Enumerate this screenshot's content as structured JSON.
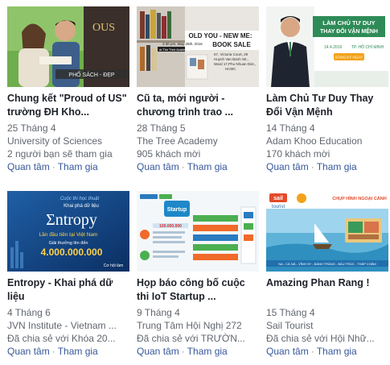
{
  "events": [
    {
      "title": "Chung kết \"Proud of US\" trường ĐH Kho...",
      "date": "25 Tháng 4",
      "host": "University of Sciences",
      "stat": "2 người bạn sẽ tham gia",
      "interested": "Quan tâm",
      "going": "Tham gia",
      "thumb_text": [
        "PHỐ SÁCH - ĐẸP",
        "OUS"
      ]
    },
    {
      "title": "Cũ ta, mới người - chương trình trao ...",
      "date": "28 Tháng 5",
      "host": "The Tree Academy",
      "stat": "905 khách mời",
      "interested": "Quan tâm",
      "going": "Tham gia",
      "thumb_text": [
        "OLD YOU - NEW ME:",
        "BOOK SALE",
        "2:30 pm, May 28th, 2016",
        "at The Tree Academy",
        "67, Victoria Court, 29",
        "Huynh Van Banh Str.,",
        "Ward 17,Phu Nhuan Dist.,",
        "HCMC"
      ]
    },
    {
      "title": "Làm Chủ Tư Duy Thay Đổi Vận Mệnh",
      "date": "14 Tháng 4",
      "host": "Adam Khoo Education",
      "stat": "170 khách mời",
      "interested": "Quan tâm",
      "going": "Tham gia",
      "thumb_text": [
        "LÀM CHỦ TƯ DUY",
        "THAY ĐỔI VẬN MỆNH",
        "14.4.2016",
        "TP. HỒ CHÍ MINH",
        "ĐĂNG KÝ NGAY"
      ]
    },
    {
      "title": "Entropy - Khai phá dữ liệu",
      "date": "4 Tháng 6",
      "host": "JVN Institute - Vietnam ...",
      "stat": "Đã chia sẻ với Khóa 20...",
      "interested": "Quan tâm",
      "going": "Tham gia",
      "thumb_text": [
        "Cuộc thi học thuật",
        "Khai phá dữ liệu",
        "Σntropy",
        "Lần đầu tiên tại Việt Nam",
        "Giải thưởng lên đến",
        "4.000.000.000",
        "Cơ hội làm"
      ]
    },
    {
      "title": "Họp báo công bố cuộc thi IoT Startup ...",
      "date": "9 Tháng 4",
      "host": "Trung Tâm Hội Nghị 272",
      "stat": "Đã chia sẻ với TRƯỜN...",
      "interested": "Quan tâm",
      "going": "Tham gia",
      "thumb_text": [
        "Startup",
        "100.000.000"
      ]
    },
    {
      "title": "Amazing Phan Rang !",
      "date": "15 Tháng 4",
      "host": "Sail Tourist",
      "stat": "Đã chia sẻ với Hội Nhữ...",
      "interested": "Quan tâm",
      "going": "Tham gia",
      "thumb_text": [
        "sail",
        "tourist",
        "CHỤP HÌNH NGOẠI CẢNH",
        "NA - CÀ NÁ - VĨNH HY - BÁNH TRÁNG - BÀU TRÚC - THÁP CHĂM"
      ]
    }
  ],
  "colors": {
    "title": "#1d2129",
    "meta": "#616770",
    "link": "#365899"
  }
}
